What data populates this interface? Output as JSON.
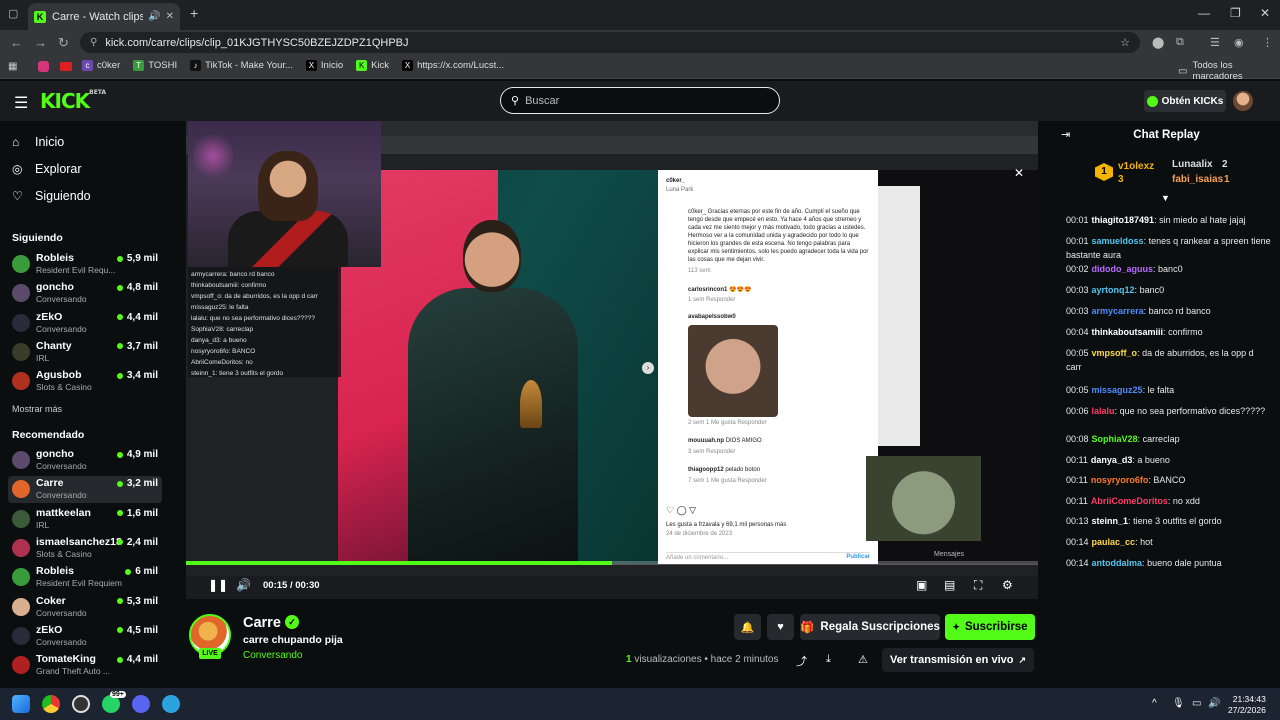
{
  "browser": {
    "tab_title": "Carre - Watch clips on Kick",
    "url": "kick.com/carre/clips/clip_01KJGTHYSC50BZEJZDPZ1QHPBJ",
    "bookmarks": [
      "c0ker",
      "TOSHI",
      "TikTok - Make Your...",
      "Inicio",
      "Kick",
      "https://x.com/Lucst..."
    ],
    "all_bookmarks": "Todos los marcadores"
  },
  "header": {
    "logo": "KICK",
    "logo_beta": "BETA",
    "search_placeholder": "Buscar",
    "kicks_button": "Obtén KICKs"
  },
  "sidebar": {
    "nav": [
      {
        "label": "Inicio",
        "icon": "home-icon"
      },
      {
        "label": "Explorar",
        "icon": "compass-icon"
      },
      {
        "label": "Siguiendo",
        "icon": "heart-icon"
      }
    ],
    "following_title": "Siguiendo",
    "following": [
      {
        "name": "Robleis",
        "category": "Resident Evil Requ...",
        "viewers": "5,9 mil",
        "color": "#3a9b3a"
      },
      {
        "name": "goncho",
        "category": "Conversando",
        "viewers": "4,8 mil",
        "color": "#5b4a6a"
      },
      {
        "name": "zEkO",
        "category": "Conversando",
        "viewers": "4,4 mil",
        "color": "#2a2a3a"
      },
      {
        "name": "Chanty",
        "category": "IRL",
        "viewers": "3,7 mil",
        "color": "#3b3b2a"
      },
      {
        "name": "Agusbob",
        "category": "Slots & Casino",
        "viewers": "3,4 mil",
        "color": "#b03020"
      }
    ],
    "show_more": "Mostrar más",
    "recommended_title": "Recomendado",
    "recommended": [
      {
        "name": "goncho",
        "category": "Conversando",
        "viewers": "4,9 mil",
        "color": "#5b4a6a"
      },
      {
        "name": "Carre",
        "category": "Conversando",
        "viewers": "3,2 mil",
        "color": "#e0662a"
      },
      {
        "name": "mattkeelan",
        "category": "IRL",
        "viewers": "1,6 mil",
        "color": "#3a5a3a"
      },
      {
        "name": "ismaelsanchez18",
        "category": "Slots & Casino",
        "viewers": "2,4 mil",
        "color": "#b03050"
      },
      {
        "name": "Robleis",
        "category": "Resident Evil Requiem",
        "viewers": "6 mil",
        "color": "#3a9b3a"
      },
      {
        "name": "Coker",
        "category": "Conversando",
        "viewers": "5,3 mil",
        "color": "#d8b090"
      },
      {
        "name": "zEkO",
        "category": "Conversando",
        "viewers": "4,5 mil",
        "color": "#2a2a3a"
      },
      {
        "name": "TomateKing",
        "category": "Grand Theft Auto ...",
        "viewers": "4,4 mil",
        "color": "#b02020"
      }
    ]
  },
  "video": {
    "time_current": "00:15",
    "time_total": "00:30",
    "progress": 0.5,
    "inner_chat": [
      "armycarrera: banco rd banco",
      "thinkaboutsamiii: confirmo",
      "vmpsoff_o: da de aburridos, es la opp d carr",
      "missaguz25: le falta",
      "lalalu: que no sea performativo dices?????",
      "SophiaV28: carreclap",
      "danya_d3: a bueno",
      "nosyryoro6fo: BANCO",
      "AbriiComeDoritos: no",
      "steinn_1: tiene 3 outfits el gordo"
    ],
    "ig_post": {
      "user": "c0ker_",
      "location": "Luna Park",
      "caption": "c0ker_ Gracias eternas por este fin de año. Cumplí el sueño que tengo desde que empecé en esto. Ya hace 4 años que stremeo y cada vez me siento mejor y más motivado, todo gracias a ustedes. Hermoso ver a la comunidad unida y agradecido por todo lo que hicieron los grandes de esta escena. No tengo palabras para explicar mis sentimientos, solo les puedo agradecer toda la vida por las cosas que me dejan vivir.",
      "caption_meta": "113 sem",
      "comments": [
        {
          "user": "carlosrincon1",
          "text": "😍😍😍",
          "meta": "1 sem  Responder"
        },
        {
          "user": "avabapelssobw0",
          "text": "",
          "meta": "2 sem  1 Me gusta  Responder"
        },
        {
          "user": "mouuuah.np",
          "text": "DIOS AMIGO",
          "meta": "3 sem  Responder"
        },
        {
          "user": "thiagoopp12",
          "text": "pelado boton",
          "meta": "7 sem  1 Me gusta  Responder"
        }
      ],
      "likes": "Les gusta a frzavala y 69,1 mil personas más",
      "date": "24 de diciembre de 2023",
      "add_comment": "Añade un comentario...",
      "publish": "Publicar",
      "messages": "Mensajes"
    }
  },
  "channel": {
    "name": "Carre",
    "live": "LIVE",
    "title": "carre chupando pija",
    "category": "Conversando",
    "gift_button": "Regala Suscripciones",
    "subscribe_button": "Suscribirse",
    "views_count": "1",
    "views_label": "visualizaciones",
    "ago": "• hace 2 minutos",
    "watch_live": "Ver transmisión en vivo"
  },
  "chat": {
    "title": "Chat Replay",
    "gifters": [
      {
        "name": "v1olexz",
        "count": "3",
        "rank": "1"
      },
      {
        "name": "Lunaalix",
        "count": "2"
      },
      {
        "name": "fabi_isaias",
        "count": "1"
      }
    ],
    "messages": [
      {
        "ts": "00:01",
        "user": "thiagito187491",
        "color": "#ffffff",
        "text": "sin miedo al hate jajaj"
      },
      {
        "ts": "00:01",
        "user": "samueldoss",
        "color": "#53c5f0",
        "text": "tenes q rankear a spreen tiene bastante aura"
      },
      {
        "ts": "00:02",
        "user": "didodo_aguus",
        "color": "#b86bff",
        "text": "banc0"
      },
      {
        "ts": "00:03",
        "user": "ayrtonq12",
        "color": "#53c5f0",
        "text": "banc0"
      },
      {
        "ts": "00:03",
        "user": "armycarrera",
        "color": "#4f8cff",
        "text": "banco rd banco"
      },
      {
        "ts": "00:04",
        "user": "thinkaboutsamiii",
        "color": "#ffffff",
        "text": "confirmo"
      },
      {
        "ts": "00:05",
        "user": "vmpsoff_o",
        "color": "#ffd84a",
        "text": "da de aburridos, es la opp d carr"
      },
      {
        "ts": "00:05",
        "user": "missaguz25",
        "color": "#4f8cff",
        "text": "le falta"
      },
      {
        "ts": "00:06",
        "user": "lalalu",
        "color": "#ff3b6b",
        "text": "que no sea performativo dices?????"
      },
      {
        "ts": "00:08",
        "user": "SophiaV28",
        "color": "#53fc18",
        "text": "carreclap"
      },
      {
        "ts": "00:11",
        "user": "danya_d3",
        "color": "#ffffff",
        "text": "a bueno"
      },
      {
        "ts": "00:11",
        "user": "nosyryoro6fo",
        "color": "#ff7a2a",
        "text": "BANCO"
      },
      {
        "ts": "00:11",
        "user": "AbriiComeDoritos",
        "color": "#ff3b6b",
        "text": "no xdd"
      },
      {
        "ts": "00:13",
        "user": "steinn_1",
        "color": "#ffffff",
        "text": "tiene 3 outfits el gordo"
      },
      {
        "ts": "00:14",
        "user": "paulac_cc",
        "color": "#ffd84a",
        "text": "hot"
      },
      {
        "ts": "00:14",
        "user": "antoddalma",
        "color": "#53c5f0",
        "text": "bueno dale puntua"
      }
    ]
  },
  "taskbar": {
    "time": "21:34:43",
    "date": "27/2/2026",
    "badge_count": "99+"
  },
  "colors": {
    "accent": "#53fc18",
    "background": "#0b0e0f",
    "panel": "#191b1f"
  }
}
